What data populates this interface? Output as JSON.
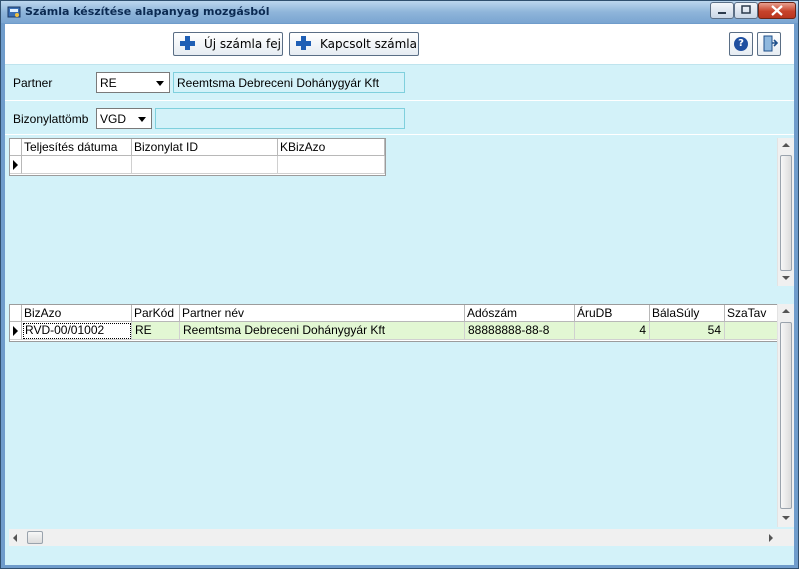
{
  "window": {
    "title": "Számla készítése alapanyag mozgásból"
  },
  "toolbar": {
    "new_invoice_label": "Új számla fej",
    "linked_invoice_label": "Kapcsolt számla",
    "help_glyph": "?"
  },
  "form": {
    "partner_label": "Partner",
    "partner_code": "RE",
    "partner_name": "Reemtsma Debreceni Dohánygyár Kft",
    "voucher_block_label": "Bizonylattömb",
    "voucher_block_code": "VGD",
    "voucher_block_name": ""
  },
  "top_grid": {
    "columns": [
      "Teljesítés dátuma",
      "Bizonylat ID",
      "KBizAzo"
    ],
    "rows": [
      [
        "",
        "",
        ""
      ]
    ]
  },
  "bottom_grid": {
    "columns": [
      "BizAzo",
      "ParKód",
      "Partner név",
      "Adószám",
      "ÁruDB",
      "BálaSúly",
      "SzaTav"
    ],
    "rows": [
      [
        "RVD-00/01002",
        "RE",
        "Reemtsma Debreceni Dohánygyár Kft",
        "88888888-88-8",
        "4",
        "54",
        ""
      ]
    ]
  },
  "colors": {
    "window_frame": "#6f9ccb",
    "client_bg": "#d3f2f9",
    "selected_row_bg": "#e2f7d3",
    "icon_blue": "#1f5fb5"
  },
  "icons": [
    "app-icon",
    "plus-icon",
    "help-icon",
    "exit-door-icon",
    "minimize-icon",
    "maximize-icon",
    "close-icon"
  ]
}
